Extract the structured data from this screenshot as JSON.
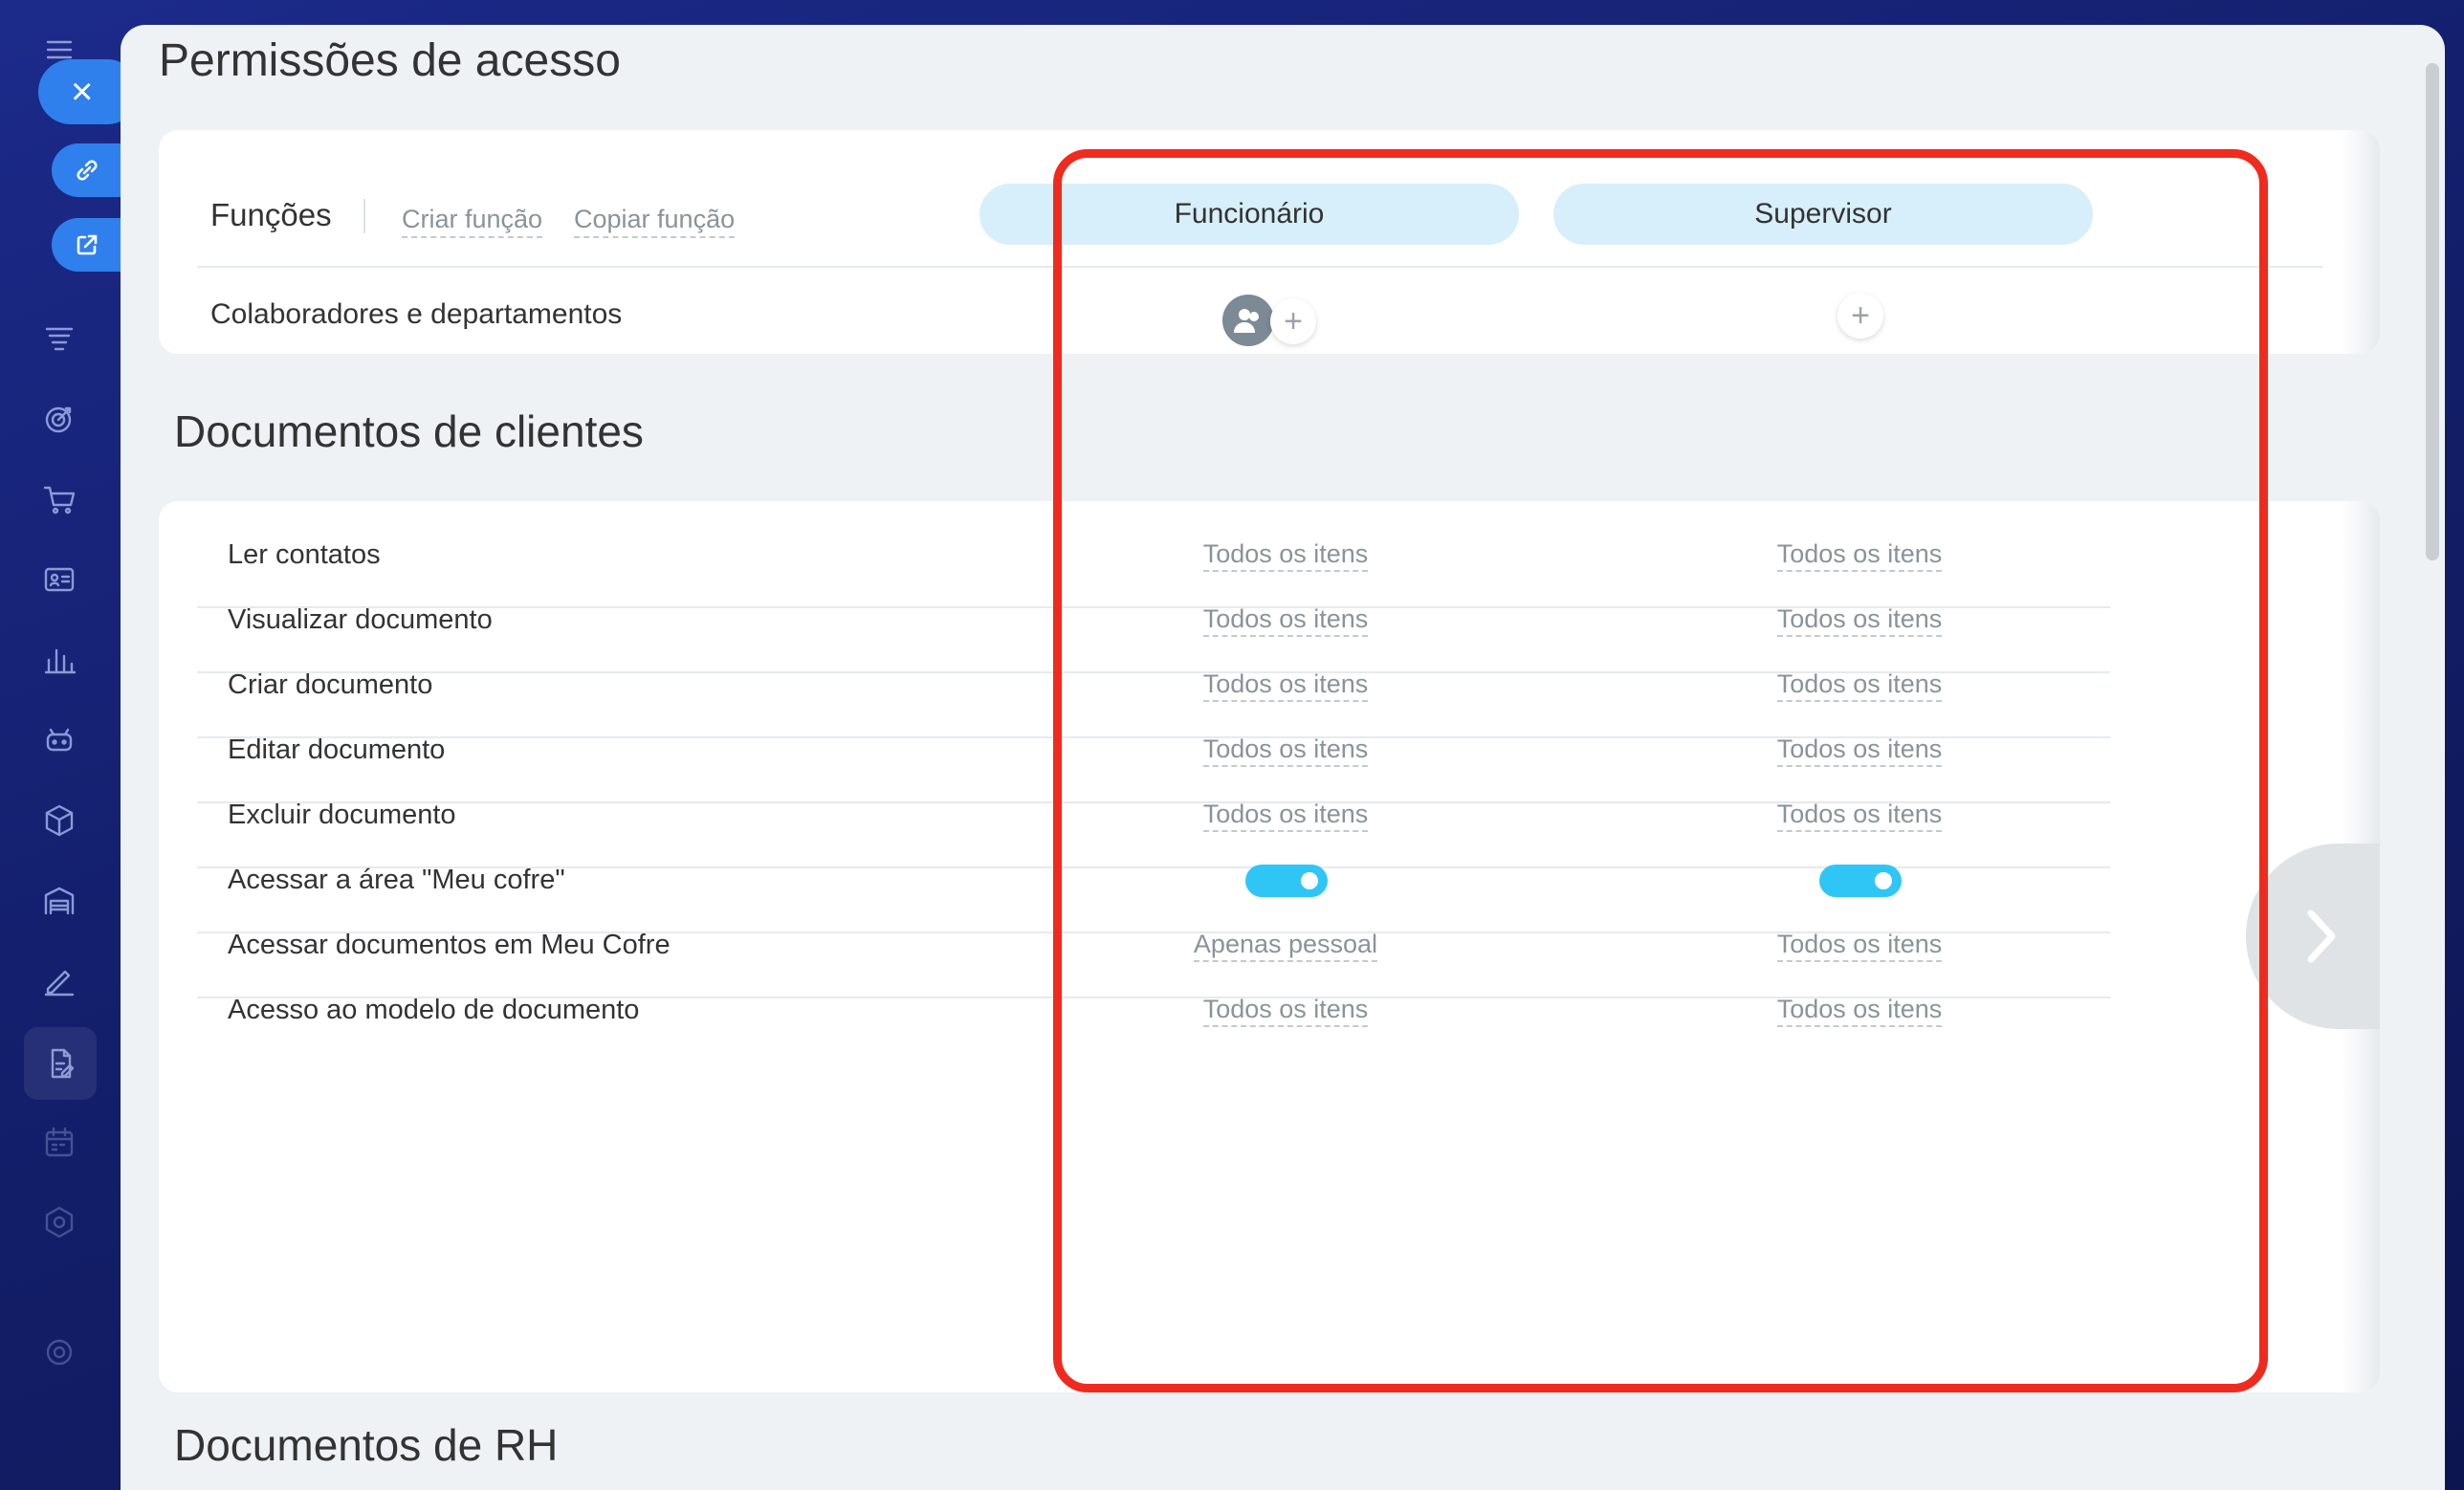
{
  "page_title": "Permissões de acesso",
  "roles_header": {
    "label": "Funções",
    "create_link": "Criar função",
    "copy_link": "Copiar função"
  },
  "roles": [
    {
      "name": "Funcionário"
    },
    {
      "name": "Supervisor"
    }
  ],
  "collaborators_label": "Colaboradores e departamentos",
  "sections": [
    {
      "title": "Documentos de clientes",
      "rows": [
        {
          "label": "Ler contatos",
          "values": [
            "Todos os itens",
            "Todos os itens"
          ]
        },
        {
          "label": "Visualizar documento",
          "values": [
            "Todos os itens",
            "Todos os itens"
          ]
        },
        {
          "label": "Criar documento",
          "values": [
            "Todos os itens",
            "Todos os itens"
          ]
        },
        {
          "label": "Editar documento",
          "values": [
            "Todos os itens",
            "Todos os itens"
          ]
        },
        {
          "label": "Excluir documento",
          "values": [
            "Todos os itens",
            "Todos os itens"
          ]
        },
        {
          "label": "Acessar a área \"Meu cofre\"",
          "toggles": [
            true,
            true
          ]
        },
        {
          "label": "Acessar documentos em Meu Cofre",
          "values": [
            "Apenas pessoal",
            "Todos os itens"
          ]
        },
        {
          "label": "Acesso ao modelo de documento",
          "values": [
            "Todos os itens",
            "Todos os itens"
          ]
        }
      ]
    },
    {
      "title": "Documentos de RH"
    }
  ],
  "colors": {
    "accent": "#2f80ed",
    "role_pill": "#d7effa",
    "toggle_on": "#2fc6f6",
    "highlight": "#ef2b1f"
  }
}
